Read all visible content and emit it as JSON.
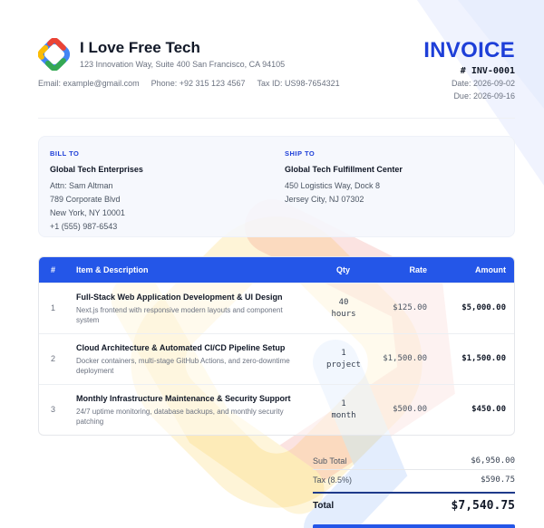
{
  "company": {
    "name": "I Love Free Tech",
    "address": "123 Innovation Way, Suite 400 San Francisco, CA 94105",
    "email": "Email: example@gmail.com",
    "phone": "Phone: +92 315 123 4567",
    "tax_id": "Tax ID: US98-7654321",
    "logo_icon": "gradient-diamond-logo",
    "brand_colors": [
      "#4285f4",
      "#ea4335",
      "#fbbc05",
      "#34a853"
    ]
  },
  "invoice": {
    "title": "INVOICE",
    "number": "# INV-0001",
    "date": "Date: 2026-09-02",
    "due": "Due: 2026-09-16",
    "accent_color": "#1e3fd8"
  },
  "bill_to": {
    "label": "BILL TO",
    "name": "Global Tech Enterprises",
    "lines": [
      "Attn: Sam Altman",
      "789 Corporate Blvd",
      "New York, NY 10001",
      "+1 (555) 987-6543"
    ]
  },
  "ship_to": {
    "label": "SHIP TO",
    "name": "Global Tech Fulfillment Center",
    "lines": [
      "450 Logistics Way, Dock 8",
      "Jersey City, NJ 07302"
    ]
  },
  "table": {
    "headers": [
      "#",
      "Item & Description",
      "Qty",
      "Rate",
      "Amount"
    ],
    "header_color": "#2456e8",
    "rows": [
      {
        "num": "1",
        "title": "Full-Stack Web Application Development & UI Design",
        "desc": "Next.js frontend with responsive modern layouts and component system",
        "qty_value": "40",
        "qty_unit": "hours",
        "rate": "$125.00",
        "amount": "$5,000.00"
      },
      {
        "num": "2",
        "title": "Cloud Architecture & Automated CI/CD Pipeline Setup",
        "desc": "Docker containers, multi-stage GitHub Actions, and zero-downtime deployment",
        "qty_value": "1",
        "qty_unit": "project",
        "rate": "$1,500.00",
        "amount": "$1,500.00"
      },
      {
        "num": "3",
        "title": "Monthly Infrastructure Maintenance & Security Support",
        "desc": "24/7 uptime monitoring, database backups, and monthly security patching",
        "qty_value": "1",
        "qty_unit": "month",
        "rate": "$500.00",
        "amount": "$450.00"
      }
    ]
  },
  "totals": {
    "subtotal_label": "Sub Total",
    "subtotal_value": "$6,950.00",
    "tax_label": "Tax (8.5%)",
    "tax_value": "$590.75",
    "total_label": "Total",
    "total_value": "$7,540.75"
  }
}
